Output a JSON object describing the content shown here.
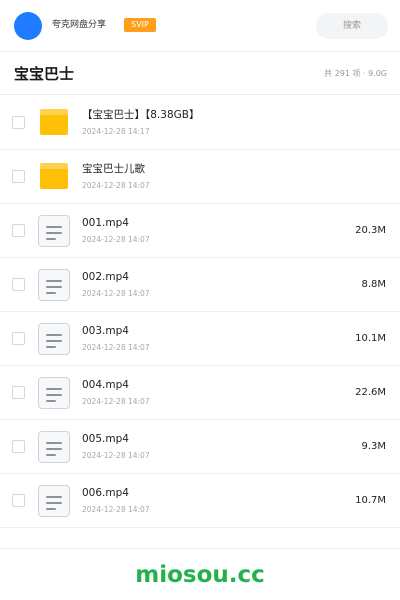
{
  "header": {
    "share_name": "夸克网盘分享",
    "vip_badge": "SVIP",
    "search_label": "搜索"
  },
  "folder": {
    "title": "宝宝巴士",
    "summary": "共 291 项 · 9.0G"
  },
  "items": [
    {
      "type": "folder",
      "name": "【宝宝巴士】【8.38GB】",
      "date": "2024-12-28 14:17",
      "size": ""
    },
    {
      "type": "folder",
      "name": "宝宝巴士儿歌",
      "date": "2024-12-28 14:07",
      "size": ""
    },
    {
      "type": "file",
      "name": "001.mp4",
      "date": "2024-12-28 14:07",
      "size": "20.3M"
    },
    {
      "type": "file",
      "name": "002.mp4",
      "date": "2024-12-28 14:07",
      "size": "8.8M"
    },
    {
      "type": "file",
      "name": "003.mp4",
      "date": "2024-12-28 14:07",
      "size": "10.1M"
    },
    {
      "type": "file",
      "name": "004.mp4",
      "date": "2024-12-28 14:07",
      "size": "22.6M"
    },
    {
      "type": "file",
      "name": "005.mp4",
      "date": "2024-12-28 14:07",
      "size": "9.3M"
    },
    {
      "type": "file",
      "name": "006.mp4",
      "date": "2024-12-28 14:07",
      "size": "10.7M"
    }
  ],
  "footer": {
    "watermark": "miosou.cc"
  },
  "colors": {
    "avatar": "#1f7bff",
    "vip_badge": "#ff9f1c",
    "folder": "#ffc107",
    "watermark": "#22b14c"
  }
}
